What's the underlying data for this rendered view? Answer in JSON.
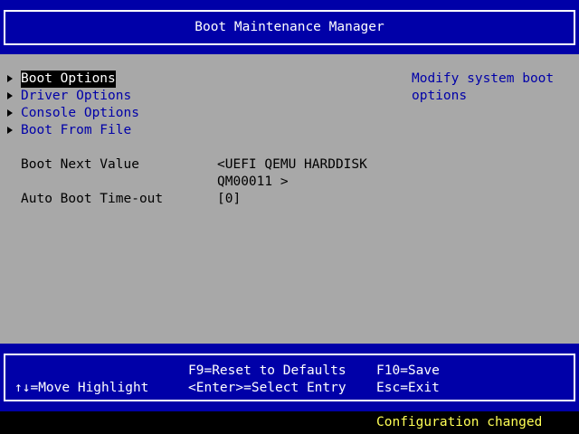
{
  "title": "Boot Maintenance Manager",
  "menu": {
    "items": [
      {
        "label": "Boot Options"
      },
      {
        "label": "Driver Options"
      },
      {
        "label": "Console Options"
      },
      {
        "label": "Boot From File"
      }
    ]
  },
  "settings": {
    "boot_next": {
      "label": "Boot Next Value",
      "value_line1": "<UEFI QEMU HARDDISK",
      "value_line2": "QM00011 >"
    },
    "auto_boot": {
      "label": "Auto Boot Time-out",
      "value": "[0]"
    }
  },
  "help": {
    "line1": "Modify system boot",
    "line2": "options"
  },
  "footer": {
    "move_highlight": "↑↓=Move Highlight",
    "reset_defaults": "F9=Reset to Defaults",
    "select_entry": "<Enter>=Select Entry",
    "save": "F10=Save",
    "exit": "Esc=Exit"
  },
  "status": "Configuration changed",
  "colors": {
    "header_bg": "#0000a8",
    "body_bg": "#a8a8a8",
    "menu_text": "#0000a8",
    "status_text": "#ffff55"
  }
}
